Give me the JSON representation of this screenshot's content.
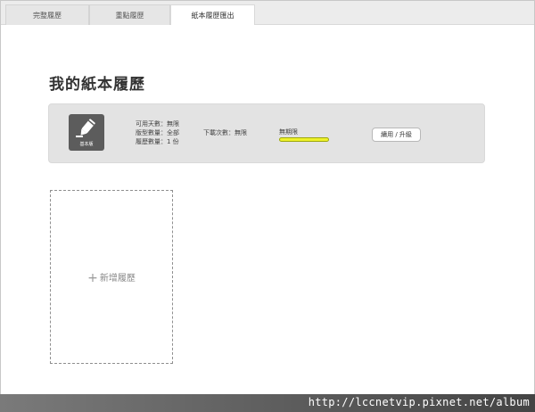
{
  "tabs": [
    {
      "label": "完整履歷"
    },
    {
      "label": "重點履歷"
    },
    {
      "label": "紙本履歷匯出"
    }
  ],
  "page_title": "我的紙本履歷",
  "plan": {
    "icon": "pen-icon",
    "badge": "基本版",
    "available_days": "可用天數：無限",
    "template_count": "版型數量：全部",
    "resume_count": "履歷數量：1 份",
    "download_count": "下載次數：無限",
    "quota_label": "無期限",
    "quota_fraction": 1.0,
    "quota_color": "#eef22a",
    "button_label": "續用 / 升級"
  },
  "add_card": {
    "plus": "+",
    "label": "新增履歷"
  },
  "watermark": "http://lccnetvip.pixnet.net/album"
}
